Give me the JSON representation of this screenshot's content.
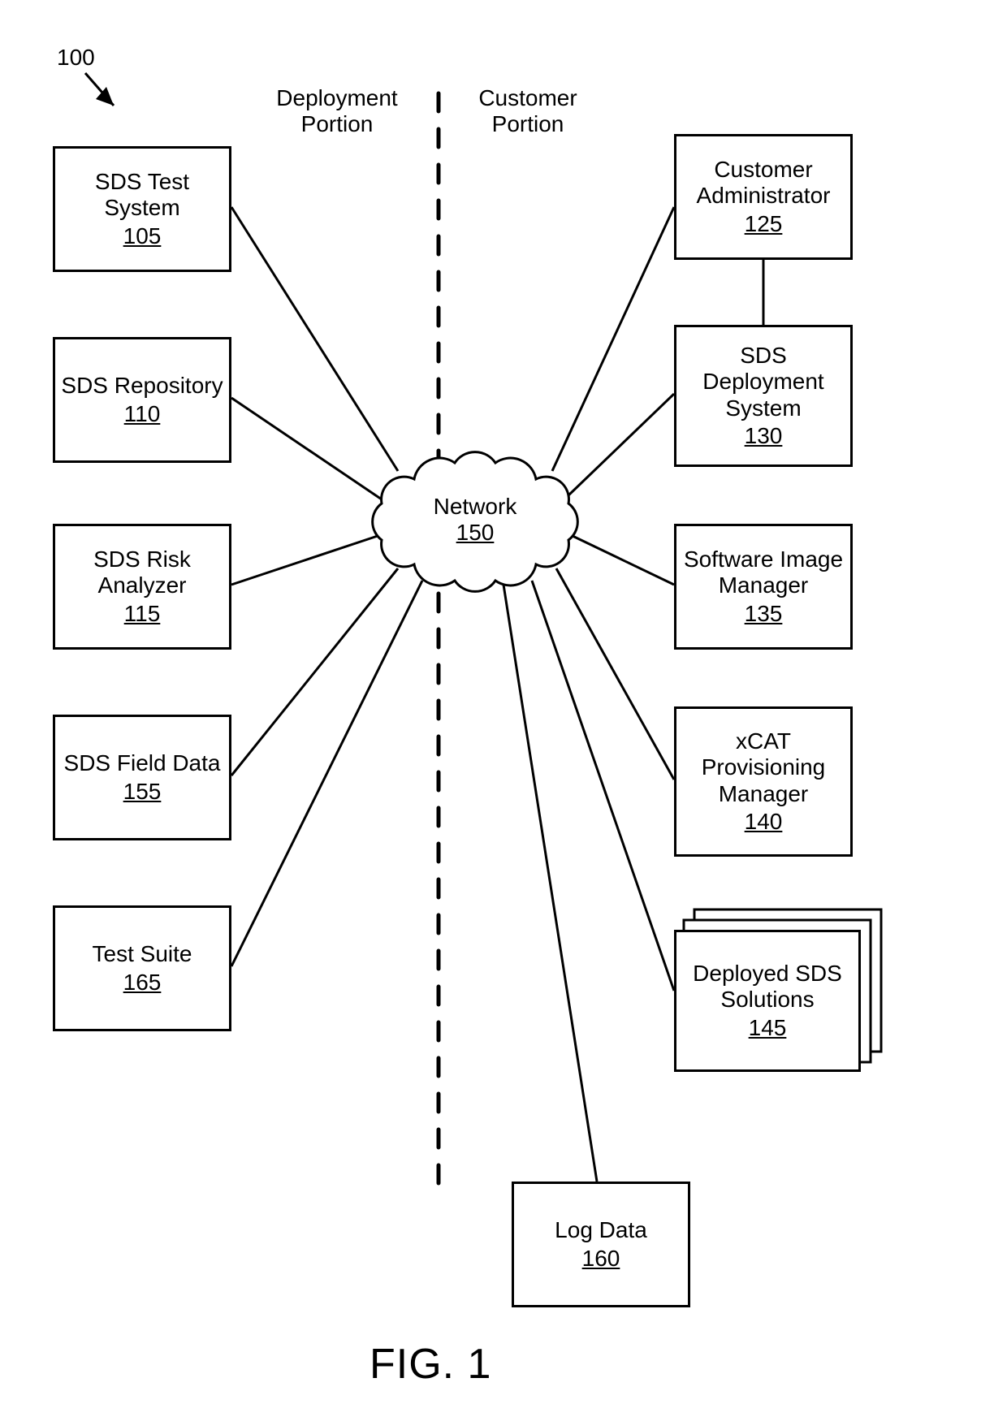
{
  "figure_ref_number": "100",
  "sections": {
    "left": {
      "line1": "Deployment",
      "line2": "Portion"
    },
    "right": {
      "line1": "Customer",
      "line2": "Portion"
    }
  },
  "center": {
    "label": "Network",
    "ref": "150"
  },
  "left_nodes": [
    {
      "l1": "SDS Test",
      "l2": "System",
      "l3": "",
      "ref": "105"
    },
    {
      "l1": "SDS Repository",
      "l2": "",
      "l3": "",
      "ref": "110"
    },
    {
      "l1": "SDS Risk",
      "l2": "Analyzer",
      "l3": "",
      "ref": "115"
    },
    {
      "l1": "SDS Field Data",
      "l2": "",
      "l3": "",
      "ref": "155"
    },
    {
      "l1": "Test Suite",
      "l2": "",
      "l3": "",
      "ref": "165"
    }
  ],
  "right_nodes": [
    {
      "l1": "Customer",
      "l2": "Administrator",
      "l3": "",
      "ref": "125"
    },
    {
      "l1": "SDS",
      "l2": "Deployment",
      "l3": "System",
      "ref": "130"
    },
    {
      "l1": "Software Image",
      "l2": "Manager",
      "l3": "",
      "ref": "135"
    },
    {
      "l1": "xCAT",
      "l2": "Provisioning",
      "l3": "Manager",
      "ref": "140"
    },
    {
      "l1": "Deployed SDS",
      "l2": "Solutions",
      "l3": "",
      "ref": "145"
    }
  ],
  "bottom_node": {
    "l1": "Log Data",
    "ref": "160"
  },
  "caption": "FIG. 1"
}
